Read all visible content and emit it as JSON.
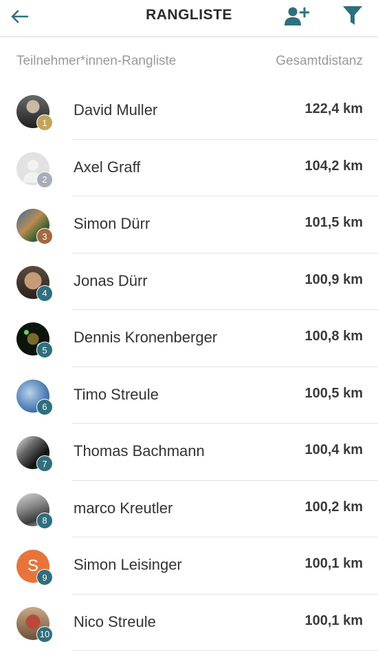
{
  "header": {
    "title": "RANGLISTE"
  },
  "columns": {
    "left": "Teilnehmer*innen-Rangliste",
    "right": "Gesamtdistanz"
  },
  "accent": "#2f6f7e",
  "participants": [
    {
      "rank": "1",
      "name": "David Muller",
      "distance": "122,4 km",
      "avatar_type": "photo",
      "badge_color": "#c2a35a"
    },
    {
      "rank": "2",
      "name": "Axel Graff",
      "distance": "104,2 km",
      "avatar_type": "placeholder",
      "badge_color": "#a9adb8"
    },
    {
      "rank": "3",
      "name": "Simon Dürr",
      "distance": "101,5 km",
      "avatar_type": "photo",
      "badge_color": "#a26a45"
    },
    {
      "rank": "4",
      "name": "Jonas Dürr",
      "distance": "100,9 km",
      "avatar_type": "photo",
      "badge_color": "#2f6f7e"
    },
    {
      "rank": "5",
      "name": "Dennis Kronenberger",
      "distance": "100,8 km",
      "avatar_type": "photo",
      "badge_color": "#2f6f7e"
    },
    {
      "rank": "6",
      "name": "Timo Streule",
      "distance": "100,5 km",
      "avatar_type": "photo",
      "badge_color": "#2f6f7e"
    },
    {
      "rank": "7",
      "name": "Thomas Bachmann",
      "distance": "100,4 km",
      "avatar_type": "photo",
      "badge_color": "#2f6f7e"
    },
    {
      "rank": "8",
      "name": "marco Kreutler",
      "distance": "100,2 km",
      "avatar_type": "photo",
      "badge_color": "#2f6f7e"
    },
    {
      "rank": "9",
      "name": "Simon Leisinger",
      "distance": "100,1 km",
      "avatar_type": "initial",
      "initial": "S",
      "badge_color": "#2f6f7e"
    },
    {
      "rank": "10",
      "name": "Nico Streule",
      "distance": "100,1 km",
      "avatar_type": "photo",
      "badge_color": "#2f6f7e"
    }
  ]
}
